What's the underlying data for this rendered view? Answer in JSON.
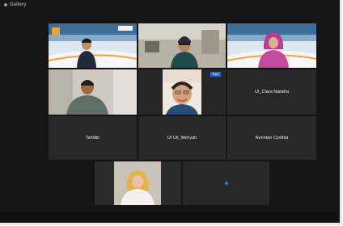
{
  "window": {
    "top_label": "Gallery"
  },
  "participants": [
    {
      "name": "",
      "camera": "on"
    },
    {
      "name": "",
      "camera": "on"
    },
    {
      "name": "",
      "camera": "on"
    },
    {
      "name": "",
      "camera": "on"
    },
    {
      "name": "",
      "camera": "on",
      "badge": "Host"
    },
    {
      "name": "UI_Clara Nailaha",
      "camera": "off"
    },
    {
      "name": "Tahidin",
      "camera": "off"
    },
    {
      "name": "UI Uti_Meriyah",
      "camera": "off"
    },
    {
      "name": "Nurintan Cynthia",
      "camera": "off"
    },
    {
      "name": "",
      "camera": "on"
    },
    {
      "name": "",
      "camera": "off"
    }
  ],
  "colors": {
    "background": "#151515",
    "tile": "#282828",
    "active_speaker": "#5fd34a",
    "badge": "#2d6ad6"
  }
}
